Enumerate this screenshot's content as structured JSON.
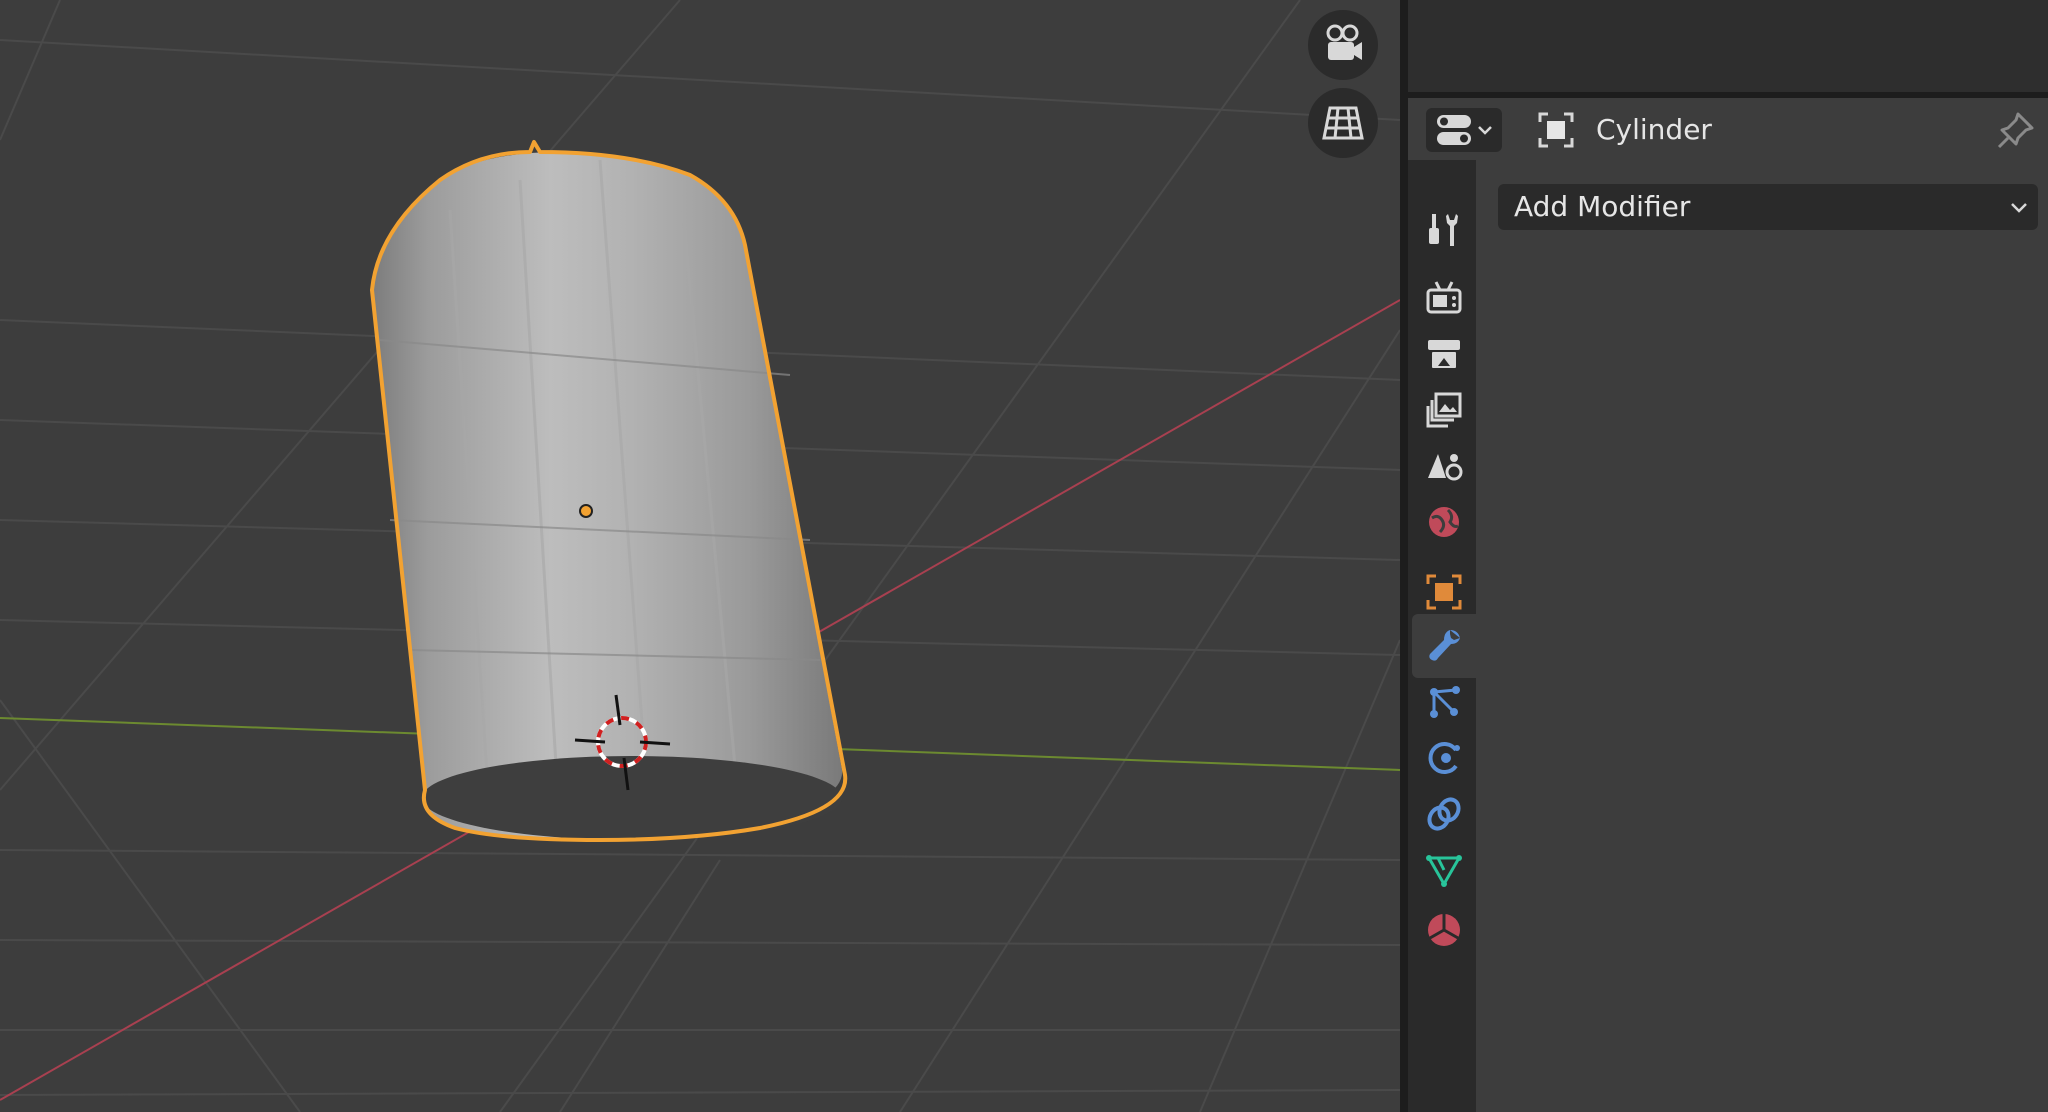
{
  "viewport": {
    "nav_buttons": [
      {
        "name": "camera-view-button",
        "icon": "camera-icon"
      },
      {
        "name": "perspective-toggle-button",
        "icon": "grid-icon"
      }
    ],
    "selected_object_outline_color": "#f2a232",
    "x_axis_color": "#a84050",
    "y_axis_color": "#6c8a30"
  },
  "properties": {
    "header": {
      "editor_type_icon": "properties-editor-icon",
      "object_icon": "object-data-icon",
      "object_name": "Cylinder",
      "pin_icon": "pin-icon"
    },
    "tabs": [
      {
        "name": "tool",
        "icon": "tool-icon"
      },
      {
        "name": "render",
        "icon": "render-icon"
      },
      {
        "name": "output",
        "icon": "output-icon"
      },
      {
        "name": "view-layer",
        "icon": "view-layer-icon"
      },
      {
        "name": "scene",
        "icon": "scene-icon"
      },
      {
        "name": "world",
        "icon": "world-icon"
      },
      {
        "name": "object",
        "icon": "object-icon"
      },
      {
        "name": "modifiers",
        "icon": "wrench-icon",
        "active": true
      },
      {
        "name": "particles",
        "icon": "particles-icon"
      },
      {
        "name": "physics",
        "icon": "physics-icon"
      },
      {
        "name": "constraints",
        "icon": "constraints-icon"
      },
      {
        "name": "data",
        "icon": "mesh-data-icon"
      },
      {
        "name": "material",
        "icon": "material-icon"
      }
    ],
    "add_modifier_label": "Add Modifier",
    "accent_color": "#5a8fd6"
  }
}
